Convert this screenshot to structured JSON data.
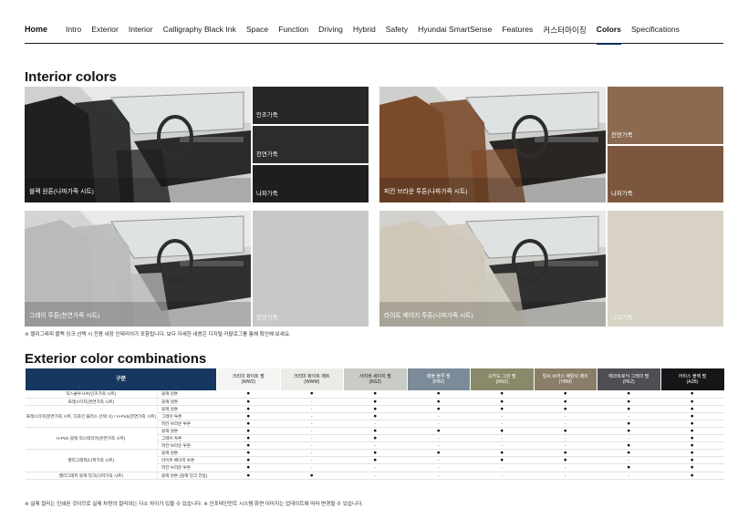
{
  "nav": {
    "home": "Home",
    "items": [
      "Intro",
      "Exterior",
      "Interior",
      "Calligraphy Black Ink",
      "Space",
      "Function",
      "Driving",
      "Hybrid",
      "Safety",
      "Hyundai SmartSense",
      "Features",
      "커스터마이징",
      "Colors",
      "Specifications"
    ],
    "active": "Colors"
  },
  "interior": {
    "title": "Interior colors",
    "groups": [
      {
        "label": "블랙 원톤(나파가죽 시트)",
        "tone": "black",
        "swatches": [
          {
            "label": "인조가죽"
          },
          {
            "label": "천연가죽"
          },
          {
            "label": "나파가죽"
          }
        ]
      },
      {
        "label": "피칸 브라운 투톤(나파가죽 시트)",
        "tone": "brown",
        "swatches": [
          {
            "label": "천연가죽"
          },
          {
            "label": "나파가죽"
          }
        ]
      },
      {
        "label": "그레이 투톤(천연가죽 시트)",
        "tone": "gray",
        "swatches": [
          {
            "label": "천연가죽"
          }
        ]
      },
      {
        "label": "라이트 베이지 투톤(나파가죽 시트)",
        "tone": "beige",
        "swatches": [
          {
            "label": "나파가죽"
          }
        ]
      }
    ],
    "note": "※ 캘리그래피 블랙 잉크 선택 시 전용 내장 인테리어가 포함됩니다. 보다 자세한 내용은 디지털 카탈로그를 통해 확인해 보세요."
  },
  "exterior": {
    "title": "Exterior color combinations",
    "header_label": "구분",
    "columns": [
      {
        "name": "크리미 화이트 펄",
        "code": "(WW2)",
        "bg": "#f4f4f2",
        "fg": "#222222"
      },
      {
        "name": "크리미 화이트 매트",
        "code": "(WWM)",
        "bg": "#ecebe7",
        "fg": "#222222"
      },
      {
        "name": "사이버 세이지 펄",
        "code": "(RS2)",
        "bg": "#c9cbc6",
        "fg": "#222222"
      },
      {
        "name": "페블 블루 펄",
        "code": "(PB2)",
        "bg": "#7c8b98",
        "fg": "#ffffff"
      },
      {
        "name": "오카도 그린 펄",
        "code": "(RN2)",
        "bg": "#8a8a6b",
        "fg": "#ffffff"
      },
      {
        "name": "얼씨 브라스 메탈릭 매트",
        "code": "(YBM)",
        "bg": "#8a7e69",
        "fg": "#ffffff"
      },
      {
        "name": "에코트로닉 그레이 펄",
        "code": "(PE2)",
        "bg": "#4d4f52",
        "fg": "#ffffff"
      },
      {
        "name": "어비스 블랙 펄",
        "code": "(A2B)",
        "bg": "#151618",
        "fg": "#ffffff"
      }
    ],
    "rows": [
      {
        "group": "익스클루시브(인조가죽 시트)",
        "span": 1,
        "sub": "블랙 원톤",
        "v": [
          "●",
          "●",
          "●",
          "●",
          "●",
          "●",
          "●",
          "●"
        ]
      },
      {
        "group": "프레스티지(천연가죽 시트)",
        "span": 1,
        "sub": "블랙 원톤",
        "v": [
          "●",
          "-",
          "●",
          "●",
          "●",
          "●",
          "●",
          "●"
        ]
      },
      {
        "group": "프레스티지(천연가죽 시트, 디자인 플러스 선택 시) / H-Pick(천연가죽 시트)",
        "span": 3,
        "sub": "블랙 원톤",
        "v": [
          "●",
          "-",
          "●",
          "●",
          "●",
          "●",
          "●",
          "●"
        ]
      },
      {
        "sub": "그레이 투톤",
        "v": [
          "●",
          "-",
          "●",
          "-",
          "-",
          "-",
          "-",
          "●"
        ]
      },
      {
        "sub": "피칸 브라운 투톤",
        "v": [
          "●",
          "-",
          "-",
          "-",
          "-",
          "-",
          "●",
          "●"
        ]
      },
      {
        "group": "H-Pick 블랙 익스테리어(천연가죽 시트)",
        "span": 3,
        "sub": "블랙 원톤",
        "v": [
          "●",
          "-",
          "●",
          "●",
          "●",
          "●",
          "●",
          "●"
        ]
      },
      {
        "sub": "그레이 투톤",
        "v": [
          "●",
          "-",
          "●",
          "-",
          "-",
          "-",
          "-",
          "●"
        ]
      },
      {
        "sub": "피칸 브라운 투톤",
        "v": [
          "●",
          "-",
          "-",
          "-",
          "-",
          "-",
          "●",
          "●"
        ]
      },
      {
        "group": "캘리그래피(나파가죽 시트)",
        "span": 3,
        "sub": "블랙 원톤",
        "v": [
          "●",
          "-",
          "●",
          "●",
          "●",
          "●",
          "●",
          "●"
        ]
      },
      {
        "sub": "라이트 베이지 투톤",
        "v": [
          "●",
          "-",
          "●",
          "-",
          "●",
          "●",
          "-",
          "●"
        ]
      },
      {
        "sub": "피칸 브라운 투톤",
        "v": [
          "●",
          "-",
          "-",
          "-",
          "-",
          "-",
          "●",
          "●"
        ]
      },
      {
        "group": "캘리그래피 블랙 잉크(나파가죽 시트)",
        "span": 1,
        "sub": "블랙 원톤 (블랙 잉크 전용)",
        "v": [
          "●",
          "●",
          "-",
          "-",
          "-",
          "-",
          "-",
          "●"
        ]
      }
    ],
    "note": "※ 실제 컬러는 인쇄된 것이므로 실제 차량의 컬러와는 다소 차이가 있을 수 있습니다.   ※ 인포테인먼트 시스템 화면 이미지는 업데이트에 따라 변경될 수 있습니다."
  }
}
